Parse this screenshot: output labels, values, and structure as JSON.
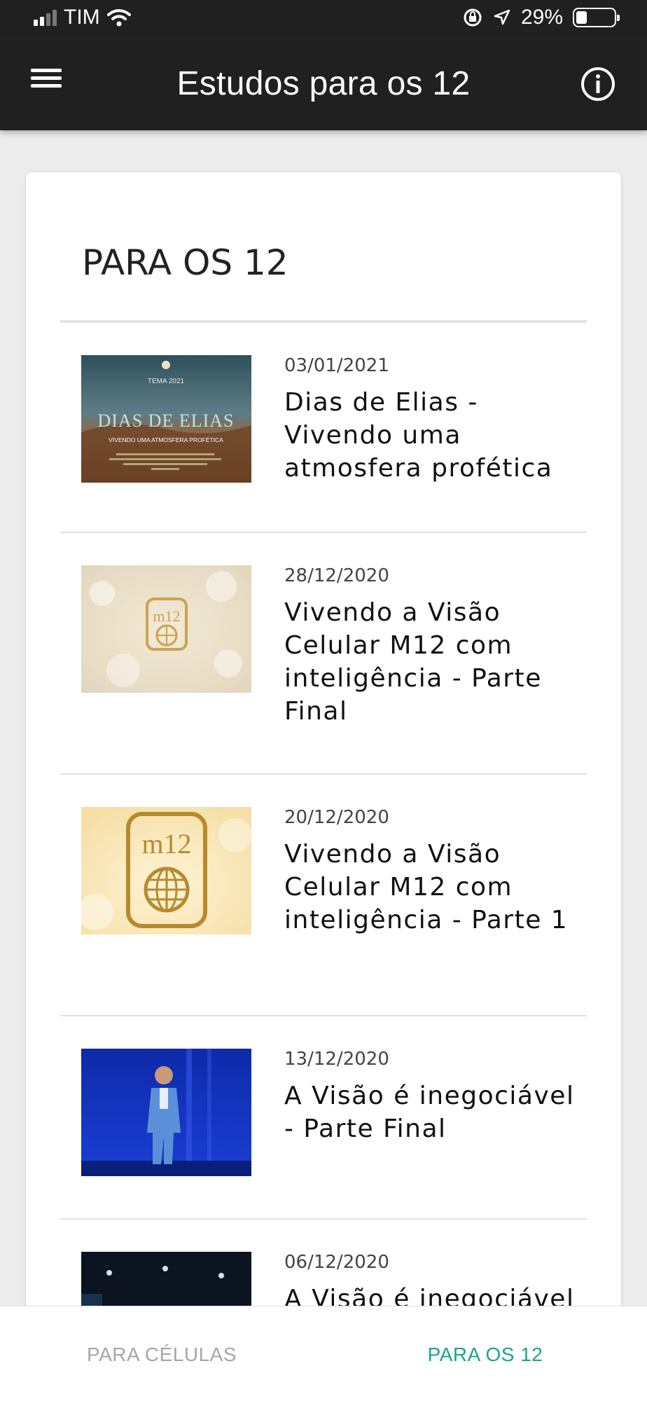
{
  "status_bar": {
    "carrier": "TIM",
    "battery": "29%",
    "battery_level": 0.29
  },
  "app_bar": {
    "title": "Estudos para os 12"
  },
  "section": {
    "title": "PARA OS 12"
  },
  "studies": [
    {
      "date": "03/01/2021",
      "title": "Dias de Elias - Vivendo uma atmosfera profética",
      "thumb_text": {
        "tema": "TEMA 2021",
        "headline": "DIAS DE ELIAS",
        "subhead": "VIVENDO UMA ATMOSFERA PROFÉTICA"
      }
    },
    {
      "date": "28/12/2020",
      "title": "Vivendo a Visão Celular M12 com inteligência - Parte Final",
      "thumb_text": {
        "logo": "m12"
      }
    },
    {
      "date": "20/12/2020",
      "title": "Vivendo a Visão Celular M12 com inteligência - Parte 1",
      "thumb_text": {
        "logo": "m12"
      }
    },
    {
      "date": "13/12/2020",
      "title": "A Visão é inegociável - Parte Final"
    },
    {
      "date": "06/12/2020",
      "title": "A Visão é inegociável"
    }
  ],
  "bottom_nav": {
    "tabs": [
      {
        "label": "PARA CÉLULAS",
        "active": false
      },
      {
        "label": "PARA OS 12",
        "active": true
      }
    ]
  },
  "colors": {
    "app_bar": "#202020",
    "accent": "#1aa58c",
    "inactive_tab": "#a6a6a6",
    "background": "#ececec"
  },
  "icons": {
    "menu": "hamburger-menu-icon",
    "info": "info-circle-icon",
    "wifi": "wifi-icon",
    "orientation_lock": "orientation-lock-icon",
    "location": "location-arrow-icon",
    "battery": "battery-icon"
  }
}
